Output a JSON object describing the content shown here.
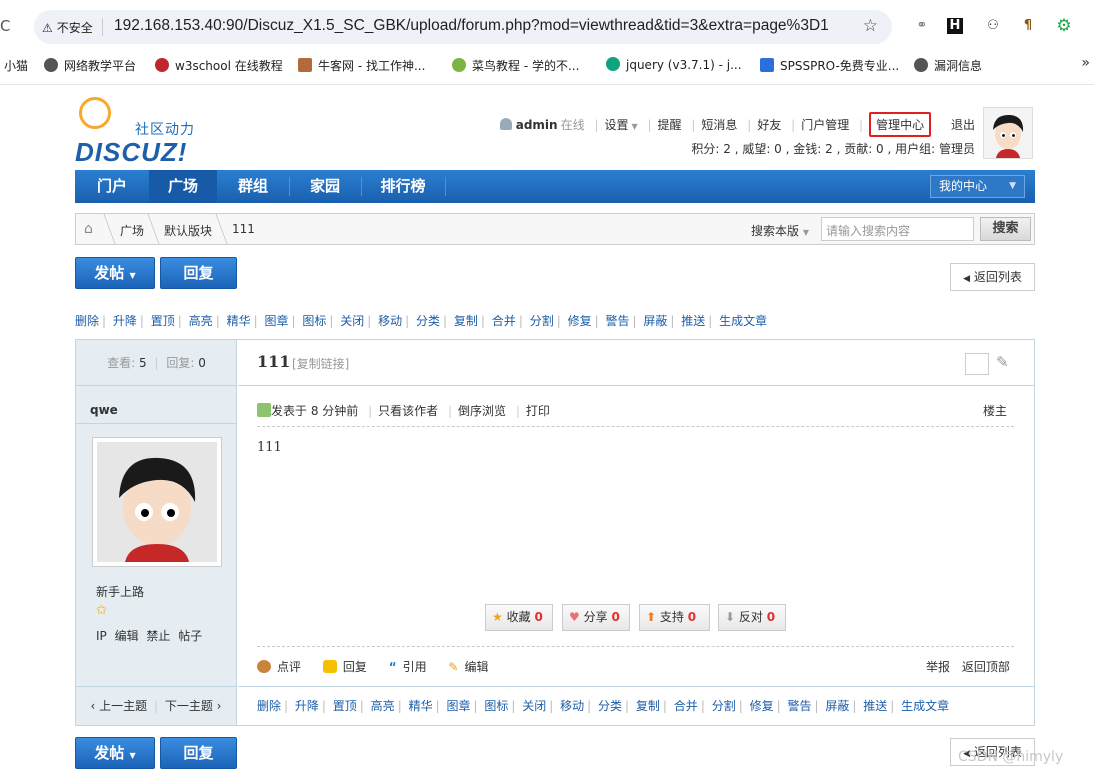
{
  "browser": {
    "insecure_label": "不安全",
    "url": "192.168.153.40:90/Discuz_X1.5_SC_GBK/upload/forum.php?mod=viewthread&tid=3&extra=page%3D1",
    "bookmarks": [
      "小猫",
      "网络教学平台",
      "w3school 在线教程",
      "牛客网 - 找工作神...",
      "菜鸟教程 - 学的不...",
      "jquery (v3.7.1) - j...",
      "SPSSPRO-免费专业...",
      "漏洞信息"
    ]
  },
  "header": {
    "logo_sub": "社区动力",
    "logo_main": "DISCUZ!",
    "username": "admin",
    "online": "在线",
    "links": [
      "设置",
      "提醒",
      "短消息",
      "好友",
      "门户管理",
      "管理中心",
      "退出"
    ],
    "credits": "积分: 2 , 威望: 0 , 金钱: 2 , 贡献: 0 , 用户组: 管理员"
  },
  "nav": {
    "items": [
      "门户",
      "广场",
      "群组",
      "家园",
      "排行榜"
    ],
    "my_center": "我的中心"
  },
  "breadcrumb": {
    "items": [
      "广场",
      "默认版块",
      "111"
    ],
    "search_scope": "搜索本版",
    "search_placeholder": "请输入搜索内容",
    "search_button": "搜索"
  },
  "actions": {
    "new_post": "发帖",
    "reply": "回复",
    "back_to_list": "返回列表"
  },
  "mod_links": [
    "删除",
    "升降",
    "置顶",
    "高亮",
    "精华",
    "图章",
    "图标",
    "关闭",
    "移动",
    "分类",
    "复制",
    "合并",
    "分割",
    "修复",
    "警告",
    "屏蔽",
    "推送",
    "生成文章"
  ],
  "thread": {
    "views_label": "查看:",
    "views": "5",
    "replies_label": "回复:",
    "replies": "0",
    "title": "111",
    "copy_link": "[复制链接]",
    "author": "qwe",
    "rank": "新手上路",
    "user_actions": "IP 编辑 禁止 帖子",
    "posted": "发表于 8 分钟前",
    "only_author": "只看该作者",
    "reverse": "倒序浏览",
    "print": "打印",
    "floor": "楼主",
    "content": "111",
    "votes": [
      {
        "label": "收藏",
        "count": "0"
      },
      {
        "label": "分享",
        "count": "0"
      },
      {
        "label": "支持",
        "count": "0"
      },
      {
        "label": "反对",
        "count": "0"
      }
    ],
    "post_actions": [
      "点评",
      "回复",
      "引用",
      "编辑"
    ],
    "report": "举报",
    "back_top": "返回顶部",
    "prev_topic": "‹ 上一主题",
    "next_topic": "下一主题 ›"
  },
  "watermark": "CSDN @himyly"
}
